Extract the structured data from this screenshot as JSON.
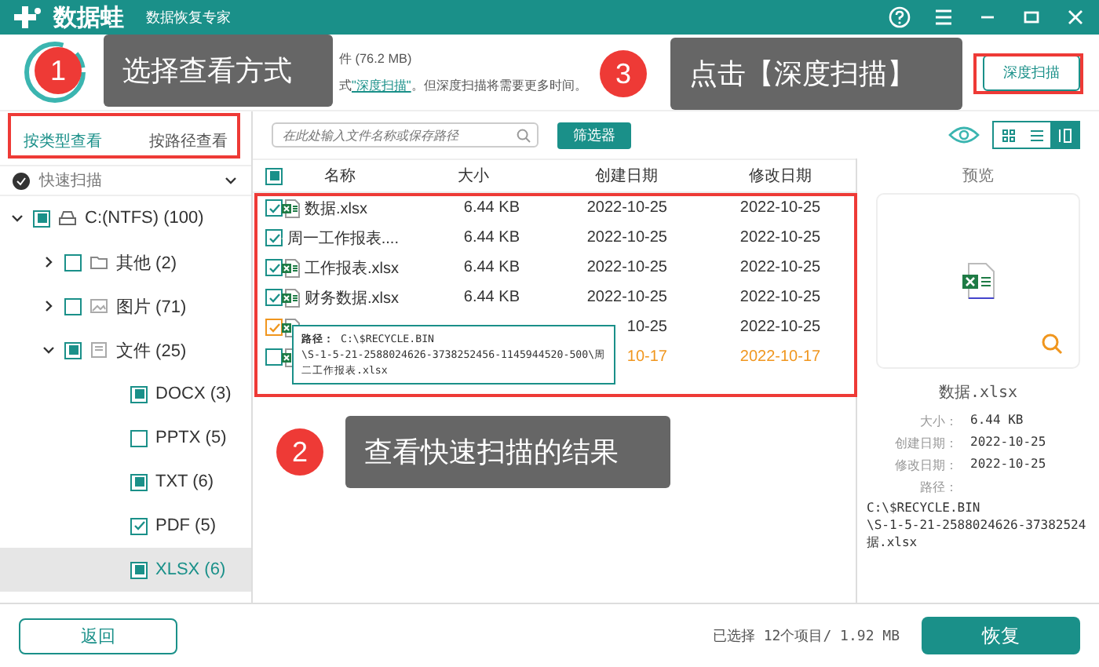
{
  "header": {
    "app_name": "数据蛙",
    "subtitle": "数据恢复专家"
  },
  "scan_info": {
    "line_1": "件 (76.2 MB)",
    "line_2": "式",
    "link": "\"深度扫描\"",
    "line_2_end": "。但深度扫描将需要更多时间。"
  },
  "deep_scan_button": "深度扫描",
  "view_tabs": [
    {
      "label": "按类型查看",
      "selected": true
    },
    {
      "label": "按路径查看",
      "selected": false
    }
  ],
  "quick_scan": {
    "label": "快速扫描",
    "expanded": true
  },
  "tree": [
    {
      "kind": "drive",
      "label": "C:(NTFS) (100)",
      "checked": true,
      "partial": true,
      "expanded": true,
      "selected": false,
      "children": [
        {
          "kind": "folder",
          "label": "其他 (2)",
          "checked": false,
          "expanded": false,
          "selected": false
        },
        {
          "kind": "image",
          "label": "图片 (71)",
          "checked": false,
          "expanded": false,
          "selected": false
        },
        {
          "kind": "document",
          "label": "文件 (25)",
          "checked": true,
          "partial": true,
          "expanded": true,
          "selected": false,
          "children": [
            {
              "kind": "type",
              "label": "DOCX (3)",
              "checked": true,
              "partial": true,
              "selected": false
            },
            {
              "kind": "type",
              "label": "PPTX (5)",
              "checked": false,
              "selected": false
            },
            {
              "kind": "type",
              "label": "TXT (6)",
              "checked": true,
              "partial": true,
              "selected": false
            },
            {
              "kind": "type",
              "label": "PDF (5)",
              "checked": true,
              "selected": false
            },
            {
              "kind": "type",
              "label": "XLSX (6)",
              "checked": true,
              "partial": true,
              "selected": true
            }
          ]
        }
      ]
    }
  ],
  "search": {
    "placeholder": "在此处输入文件名称或保存路径"
  },
  "filter_button": "筛选器",
  "view_modes": [
    {
      "selected": false
    },
    {
      "selected": false
    },
    {
      "selected": true
    }
  ],
  "table": {
    "select_all": true,
    "select_all_partial": true,
    "columns": [
      "名称",
      "大小",
      "创建日期",
      "修改日期"
    ],
    "rows": [
      {
        "checked": true,
        "hover": false,
        "color": "#333333",
        "name": "数据.xlsx",
        "size": "6.44 KB",
        "created": "2022-10-25",
        "modified": "2022-10-25"
      },
      {
        "checked": true,
        "hover": false,
        "color": "#333333",
        "name": "周一工作报表....",
        "size": "6.44 KB",
        "created": "2022-10-25",
        "modified": "2022-10-25"
      },
      {
        "checked": true,
        "hover": false,
        "color": "#333333",
        "name": "工作报表.xlsx",
        "size": "6.44 KB",
        "created": "2022-10-25",
        "modified": "2022-10-25"
      },
      {
        "checked": true,
        "hover": false,
        "color": "#333333",
        "name": "财务数据.xlsx",
        "size": "6.44 KB",
        "created": "2022-10-25",
        "modified": "2022-10-25"
      },
      {
        "checked": true,
        "hover": true,
        "color": "#333333",
        "created": "10-25",
        "modified": "2022-10-25"
      },
      {
        "checked": false,
        "hover": false,
        "color": "#f0961e",
        "created": "10-17",
        "modified": "2022-10-17"
      }
    ]
  },
  "tooltip": {
    "label": "路径：",
    "lines": [
      "C:\\$RECYCLE.BIN",
      "\\S-1-5-21-2588024626-3738252456-1145944520-500\\周",
      "二工作报表.xlsx"
    ]
  },
  "preview": {
    "title": "预览",
    "file_name": "数据.xlsx",
    "fields": [
      {
        "label": "大小：",
        "value": "6.44 KB"
      },
      {
        "label": "创建日期：",
        "value": "2022-10-25"
      },
      {
        "label": "修改日期：",
        "value": "2022-10-25"
      }
    ],
    "path_label": "路径：",
    "path_lines": [
      "C:\\$RECYCLE.BIN",
      "\\S-1-5-21-2588024626-37382524",
      "据.xlsx"
    ]
  },
  "footer": {
    "back_button": "返回",
    "status": "已选择 12个项目/ 1.92 MB",
    "recover_button": "恢复"
  },
  "callouts": [
    {
      "number": "1",
      "text": "选择查看方式"
    },
    {
      "number": "3",
      "text": "点击【深度扫描】"
    },
    {
      "number": "2",
      "text": "查看快速扫描的结果"
    }
  ]
}
